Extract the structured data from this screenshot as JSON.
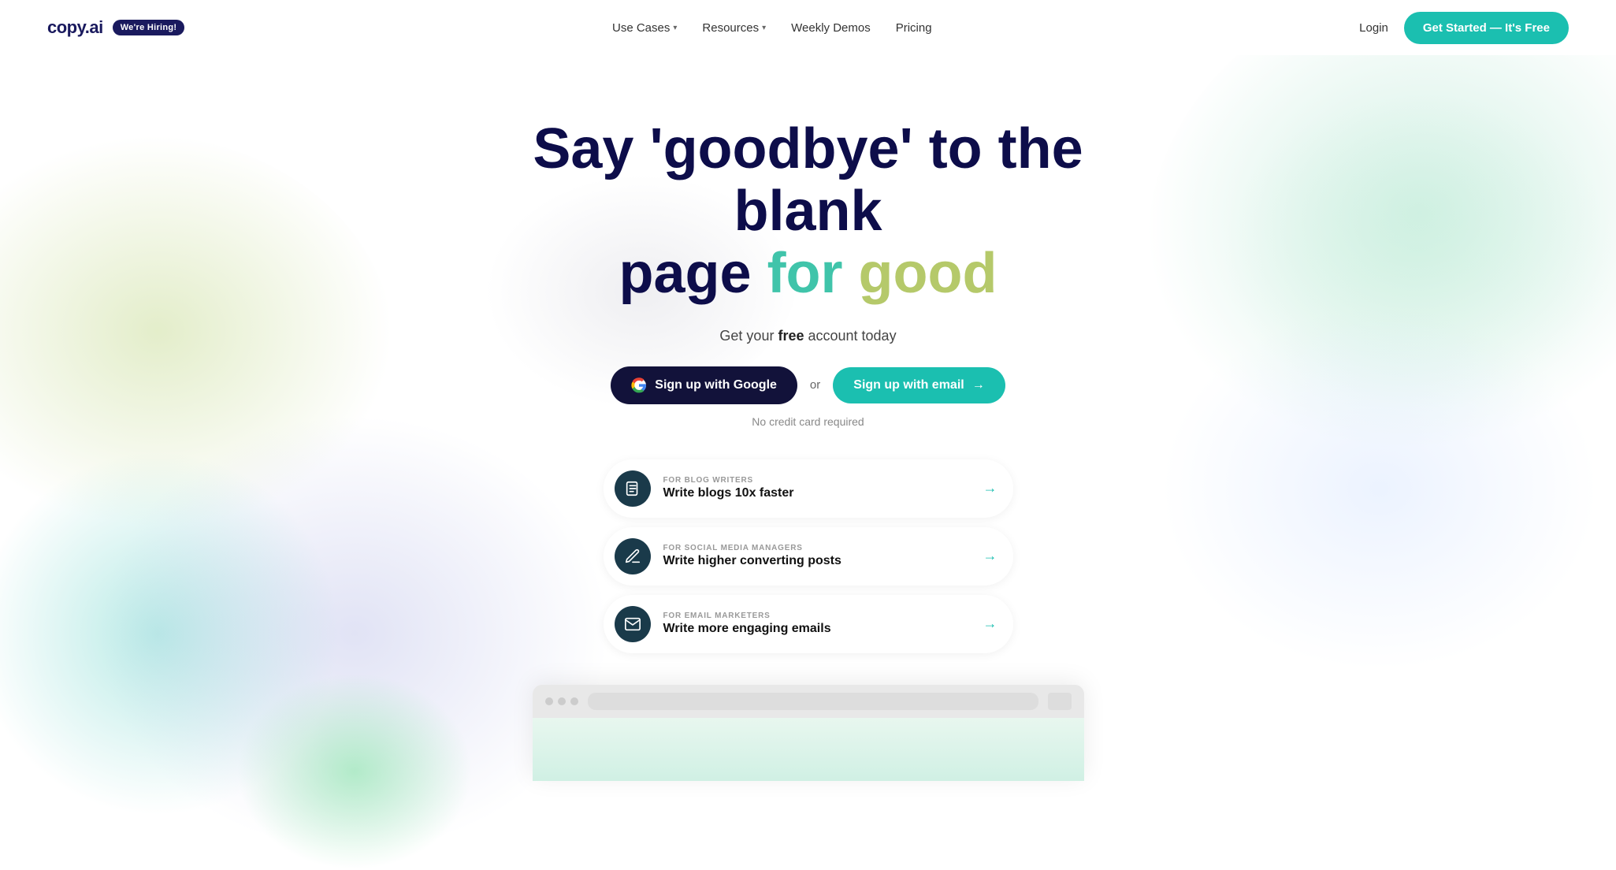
{
  "navbar": {
    "logo": "copy.ai",
    "hiring_badge": "We're Hiring!",
    "nav_items": [
      {
        "label": "Use Cases",
        "has_dropdown": true
      },
      {
        "label": "Resources",
        "has_dropdown": true
      },
      {
        "label": "Weekly Demos",
        "has_dropdown": false
      },
      {
        "label": "Pricing",
        "has_dropdown": false
      }
    ],
    "login_label": "Login",
    "cta_label": "Get Started — It's Free"
  },
  "hero": {
    "headline_line1": "Say 'goodbye' to the blank",
    "headline_line2_prefix": "page ",
    "headline_for": "for",
    "headline_good": " good",
    "subtitle_prefix": "Get your ",
    "subtitle_bold": "free",
    "subtitle_suffix": " account today",
    "btn_google": "Sign up with Google",
    "btn_email": "Sign up with email",
    "or_text": "or",
    "no_cc": "No credit card required"
  },
  "feature_cards": [
    {
      "label": "FOR BLOG WRITERS",
      "title": "Write blogs 10x faster",
      "icon": "document"
    },
    {
      "label": "FOR SOCIAL MEDIA MANAGERS",
      "title": "Write higher converting posts",
      "icon": "pencil"
    },
    {
      "label": "FOR EMAIL MARKETERS",
      "title": "Write more engaging emails",
      "icon": "envelope"
    }
  ],
  "browser_mock": {
    "visible": true
  }
}
